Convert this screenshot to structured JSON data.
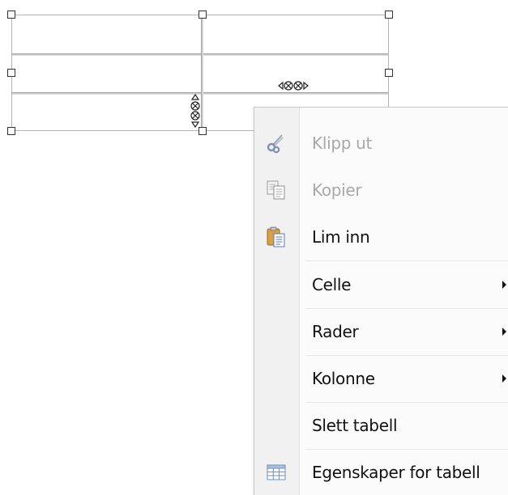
{
  "context_menu": {
    "items": [
      {
        "label": "Klipp ut",
        "icon": "scissors-icon",
        "enabled": false,
        "submenu": false
      },
      {
        "label": "Kopier",
        "icon": "copy-icon",
        "enabled": false,
        "submenu": false
      },
      {
        "label": "Lim inn",
        "icon": "paste-icon",
        "enabled": true,
        "submenu": false
      },
      {
        "label": "Celle",
        "icon": "",
        "enabled": true,
        "submenu": true
      },
      {
        "label": "Rader",
        "icon": "",
        "enabled": true,
        "submenu": true
      },
      {
        "label": "Kolonne",
        "icon": "",
        "enabled": true,
        "submenu": true
      },
      {
        "label": "Slett tabell",
        "icon": "",
        "enabled": true,
        "submenu": false
      },
      {
        "label": "Egenskaper for tabell",
        "icon": "table-properties-icon",
        "enabled": true,
        "submenu": false
      }
    ]
  },
  "colors": {
    "disabled_text": "#a8a8a8",
    "enabled_text": "#111111",
    "menu_background": "#fbfbfb",
    "icon_gutter": "#f1f1f1"
  }
}
